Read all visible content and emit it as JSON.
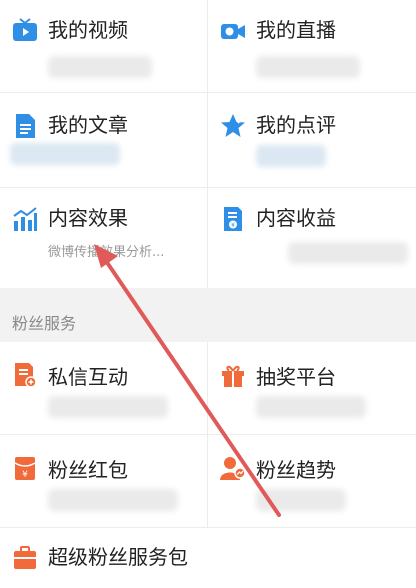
{
  "section1": {
    "items": [
      {
        "label": "我的视频"
      },
      {
        "label": "我的直播"
      },
      {
        "label": "我的文章"
      },
      {
        "label": "我的点评"
      },
      {
        "label": "内容效果",
        "sub": "微博传播效果分析..."
      },
      {
        "label": "内容收益"
      }
    ]
  },
  "section2": {
    "title": "粉丝服务",
    "items": [
      {
        "label": "私信互动"
      },
      {
        "label": "抽奖平台"
      },
      {
        "label": "粉丝红包"
      },
      {
        "label": "粉丝趋势"
      },
      {
        "label": "超级粉丝服务包"
      }
    ]
  },
  "colors": {
    "icon_blue": "#2f8ee6",
    "icon_orange": "#f06a3a",
    "arrow_red": "#e05a5a"
  },
  "icons": [
    "video-icon",
    "live-camera-icon",
    "article-icon",
    "review-star-icon",
    "bar-chart-icon",
    "income-doc-icon",
    "message-icon",
    "gift-icon",
    "red-envelope-icon",
    "fans-trend-icon",
    "service-package-icon"
  ]
}
